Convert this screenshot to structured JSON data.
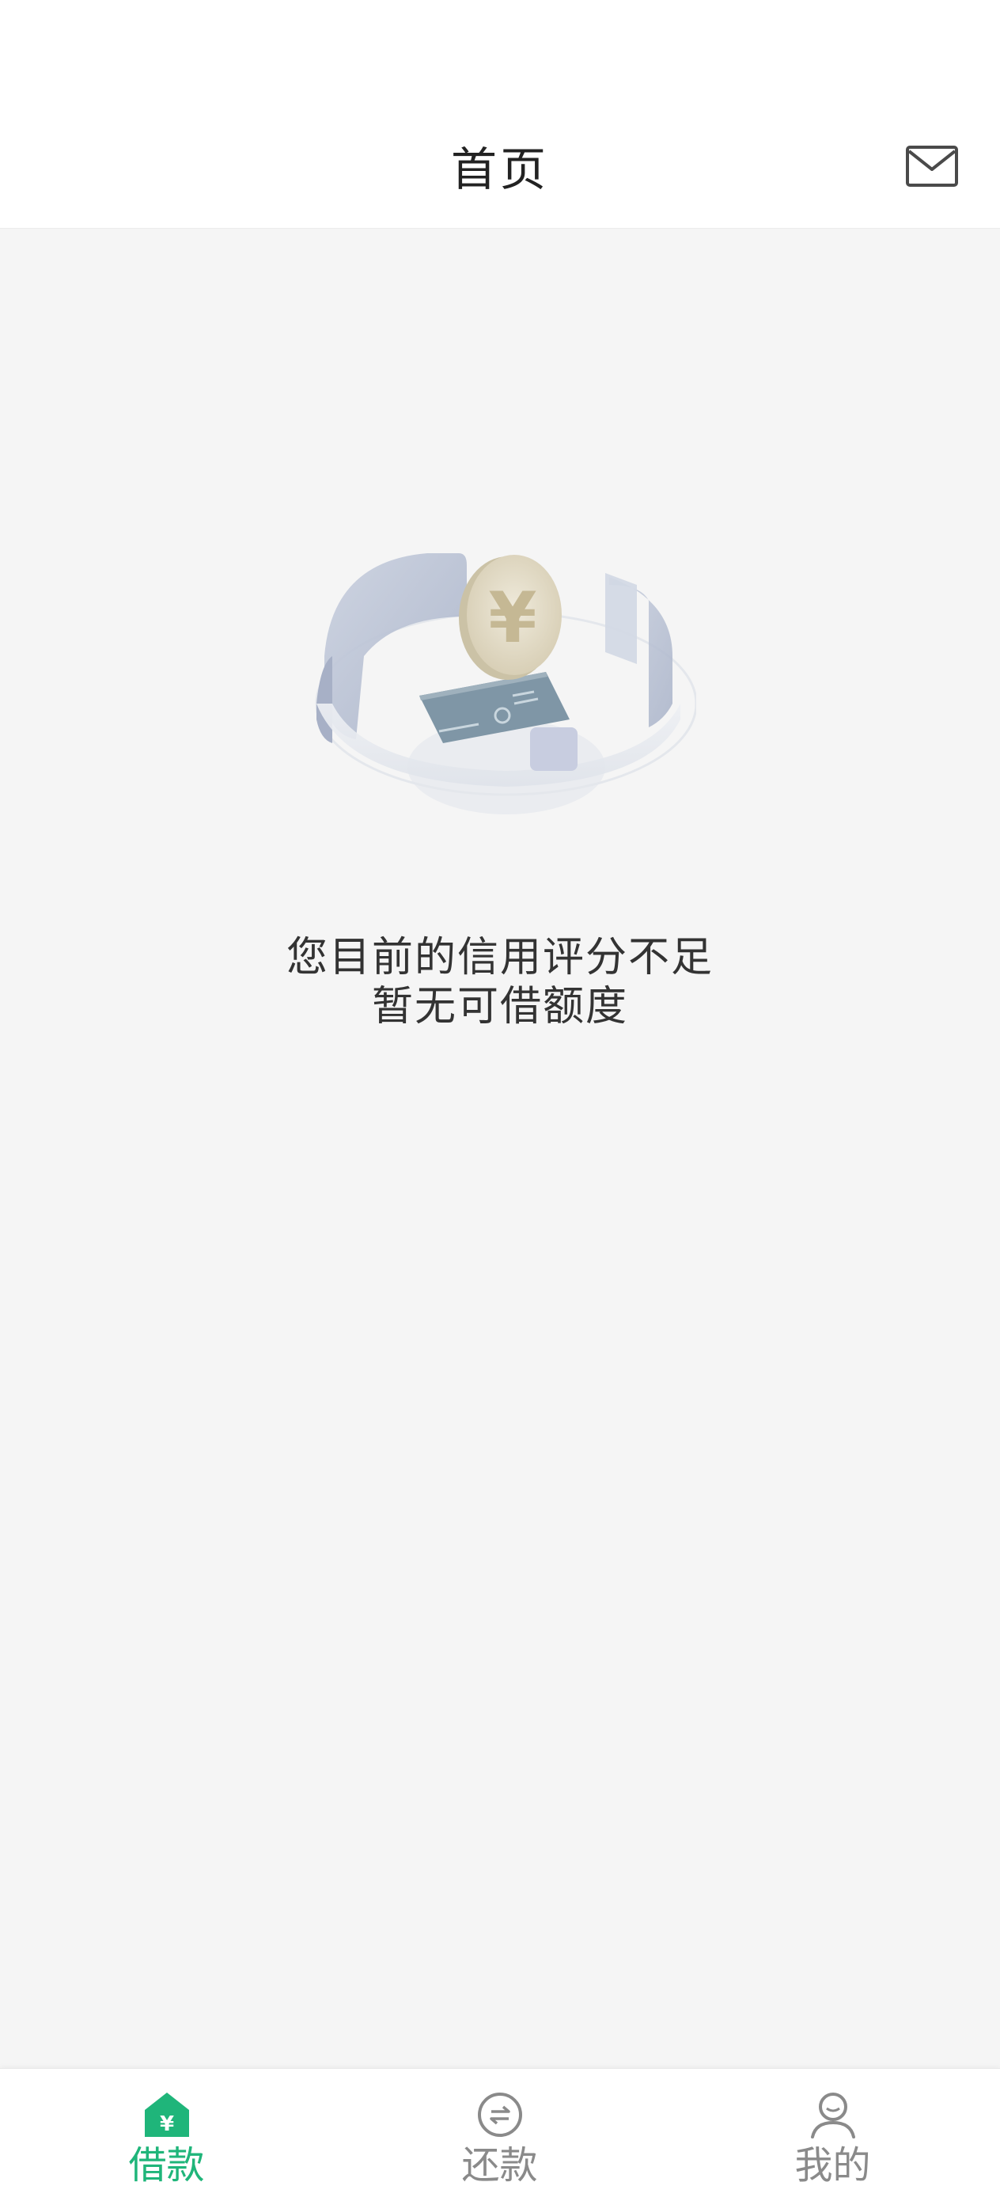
{
  "header": {
    "title": "首页",
    "mail_icon": "mail-icon"
  },
  "empty_state": {
    "illustration": "coin-shield-illustration",
    "line1": "您目前的信用评分不足",
    "line2": "暂无可借额度"
  },
  "tabbar": {
    "active_color": "#1fb57a",
    "inactive_color": "#8a8a8a",
    "items": [
      {
        "label": "借款",
        "icon": "borrow-house-icon",
        "active": true
      },
      {
        "label": "还款",
        "icon": "repay-exchange-icon",
        "active": false
      },
      {
        "label": "我的",
        "icon": "profile-icon",
        "active": false
      }
    ]
  }
}
